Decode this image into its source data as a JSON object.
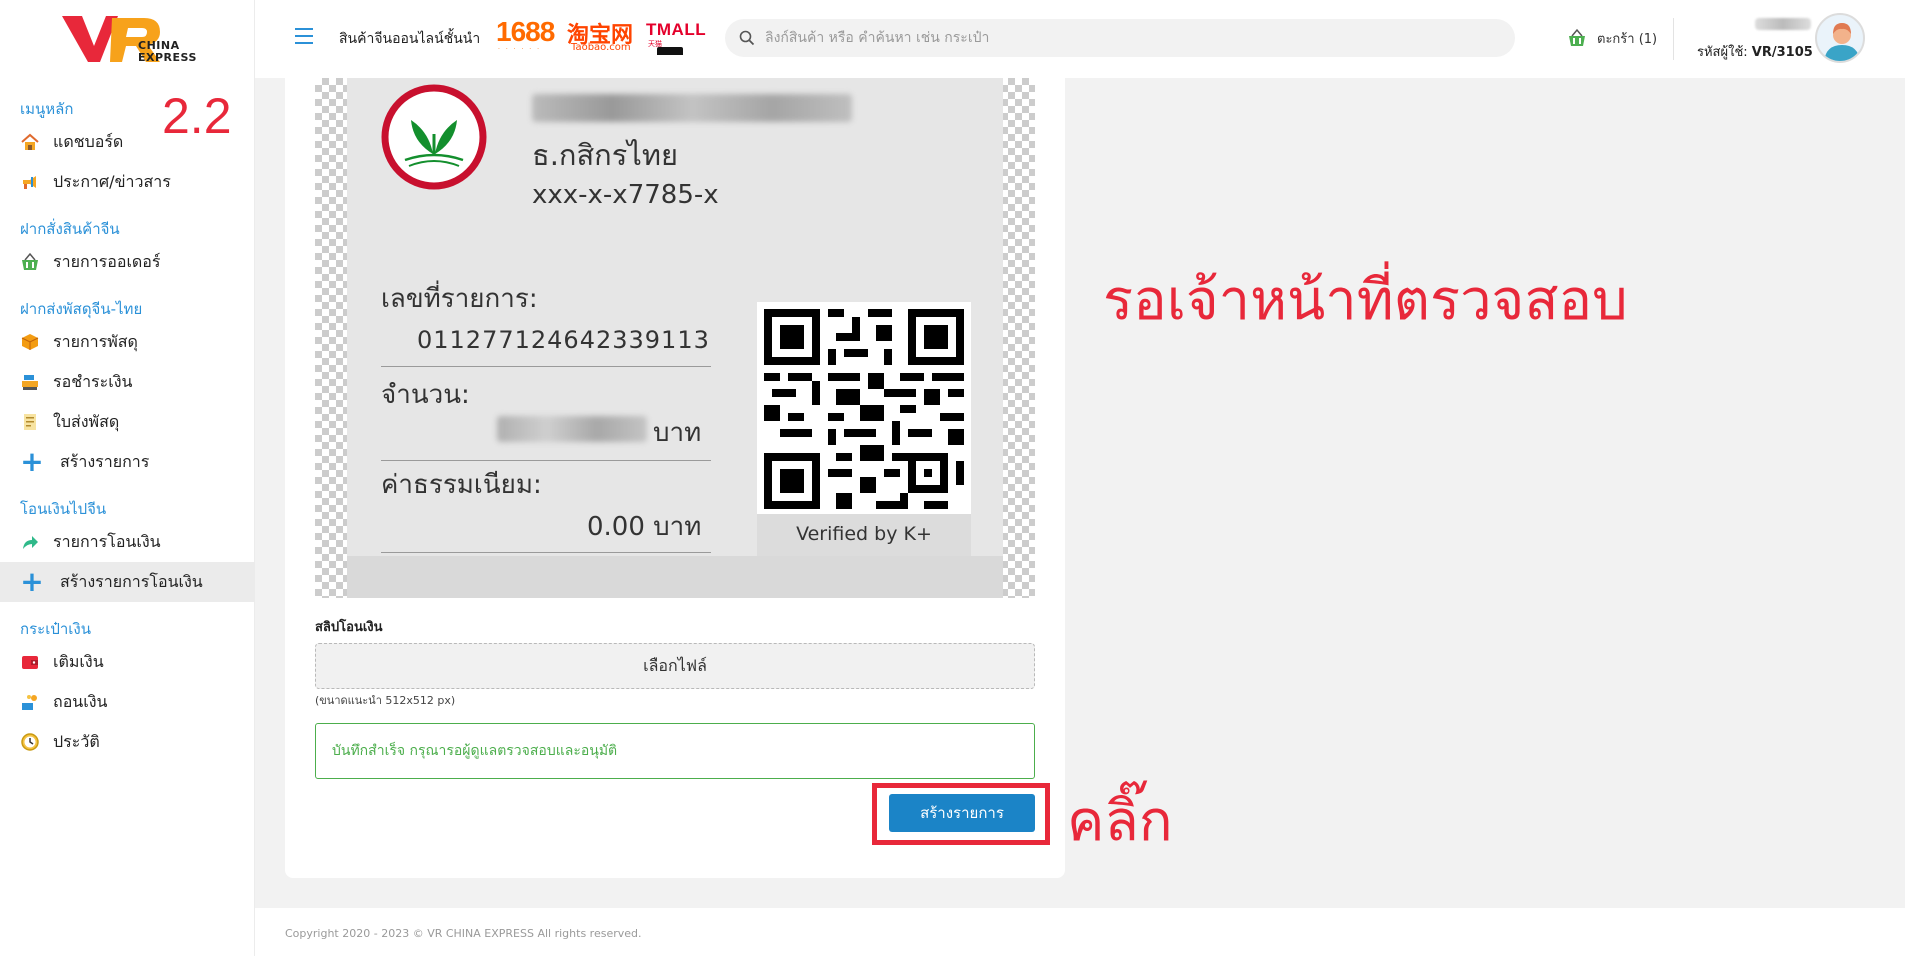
{
  "annotations": {
    "step": "2.2",
    "waiting": "รอเจ้าหน้าที่ตรวจสอบ",
    "click": "คลิ๊ก"
  },
  "logo": {
    "letters": "VR",
    "text_line1": "CHINA",
    "text_line2": "EXPRESS"
  },
  "header": {
    "tagline": "สินค้าจีนออนไลน์ชั้นนำ",
    "brands": {
      "b1688": "1688",
      "taobao": "淘宝网",
      "taobao_sub": "Taobao.com",
      "tmall": "TMALL",
      "tmall_sub": "天猫"
    },
    "search_placeholder": "ลิงก์สินค้า หรือ คำค้นหา เช่น กระเป๋า",
    "cart_label": "ตะกร้า (1)",
    "user_id_label": "รหัสผู้ใช้:",
    "user_id_value": "VR/3105"
  },
  "sidebar": {
    "sections": [
      {
        "title": "เมนูหลัก",
        "items": [
          {
            "label": "แดชบอร์ด",
            "icon": "home-icon"
          },
          {
            "label": "ประกาศ/ข่าวสาร",
            "icon": "megaphone-icon"
          }
        ]
      },
      {
        "title": "ฝากสั่งสินค้าจีน",
        "items": [
          {
            "label": "รายการออเดอร์",
            "icon": "basket-icon"
          }
        ]
      },
      {
        "title": "ฝากส่งพัสดุจีน-ไทย",
        "items": [
          {
            "label": "รายการพัสดุ",
            "icon": "box-icon"
          },
          {
            "label": "รอชำระเงิน",
            "icon": "cash-register-icon"
          },
          {
            "label": "ใบส่งพัสดุ",
            "icon": "document-icon"
          },
          {
            "label": "สร้างรายการ",
            "icon": "plus-icon"
          }
        ]
      },
      {
        "title": "โอนเงินไปจีน",
        "items": [
          {
            "label": "รายการโอนเงิน",
            "icon": "share-arrow-icon"
          },
          {
            "label": "สร้างรายการโอนเงิน",
            "icon": "plus-icon",
            "active": true
          }
        ]
      },
      {
        "title": "กระเป๋าเงิน",
        "items": [
          {
            "label": "เติมเงิน",
            "icon": "wallet-icon"
          },
          {
            "label": "ถอนเงิน",
            "icon": "withdraw-icon"
          },
          {
            "label": "ประวัติ",
            "icon": "history-icon"
          }
        ]
      }
    ]
  },
  "slip": {
    "bank_name": "ธ.กสิกรไทย",
    "account": "xxx-x-x7785-x",
    "ref_label": "เลขที่รายการ:",
    "ref_value": "011277124642339113",
    "amount_label": "จำนวน:",
    "amount_unit": "บาท",
    "fee_label": "ค่าธรรมเนียม:",
    "fee_value": "0.00 บาท",
    "verified": "Verified by K+"
  },
  "form": {
    "slip_label": "สลิปโอนเงิน",
    "file_button": "เลือกไฟล์",
    "size_hint": "(ขนาดแนะนำ 512x512 px)",
    "success_message": "บันทึกสำเร็จ กรุณารอผู้ดูแลตรวจสอบและอนุมัติ",
    "submit_button": "สร้างรายการ"
  },
  "footer": {
    "copyright": "Copyright 2020 - 2023 © VR CHINA EXPRESS All rights reserved."
  },
  "colors": {
    "accent": "#2b91d8",
    "button": "#1b84c7",
    "success": "#4cae4c",
    "annotation": "#e8283a",
    "kbank_green": "#138f2d",
    "kbank_red": "#c8102e"
  }
}
